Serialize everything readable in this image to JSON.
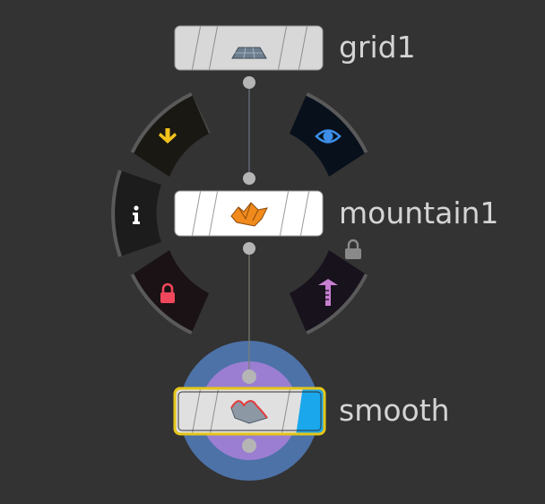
{
  "network": {
    "nodes": [
      {
        "id": "grid1",
        "label": "grid1",
        "icon": "grid-icon",
        "state": "default"
      },
      {
        "id": "mountain1",
        "label": "mountain1",
        "icon": "mountain-icon",
        "state": "hovered"
      },
      {
        "id": "smooth",
        "label": "smooth",
        "icon": "smooth-icon",
        "state": "selected-display"
      }
    ],
    "connections": [
      {
        "from": "grid1",
        "to": "mountain1"
      },
      {
        "from": "mountain1",
        "to": "smooth"
      }
    ],
    "ring_menu": {
      "top_left": {
        "icon": "bypass-arrow-icon",
        "color": "#f2c21b"
      },
      "top_right": {
        "icon": "display-eye-icon",
        "color": "#3d8ee8"
      },
      "mid_left": {
        "icon": "info-icon",
        "color": "#ffffff"
      },
      "bottom_left": {
        "icon": "lock-icon",
        "color": "#f0475c"
      },
      "bottom_right": {
        "icon": "template-icon",
        "color": "#c77fd1"
      },
      "side_badge": {
        "icon": "padlock-badge-icon"
      }
    },
    "colors": {
      "background": "#333333",
      "node_fill": "#e8e8e8",
      "selected_outline": "#e5c619",
      "display_flag": "#1aa7ec",
      "display_halo": "#4d72a8",
      "render_halo": "#9b7ed2",
      "wire": "#6e7585"
    }
  }
}
